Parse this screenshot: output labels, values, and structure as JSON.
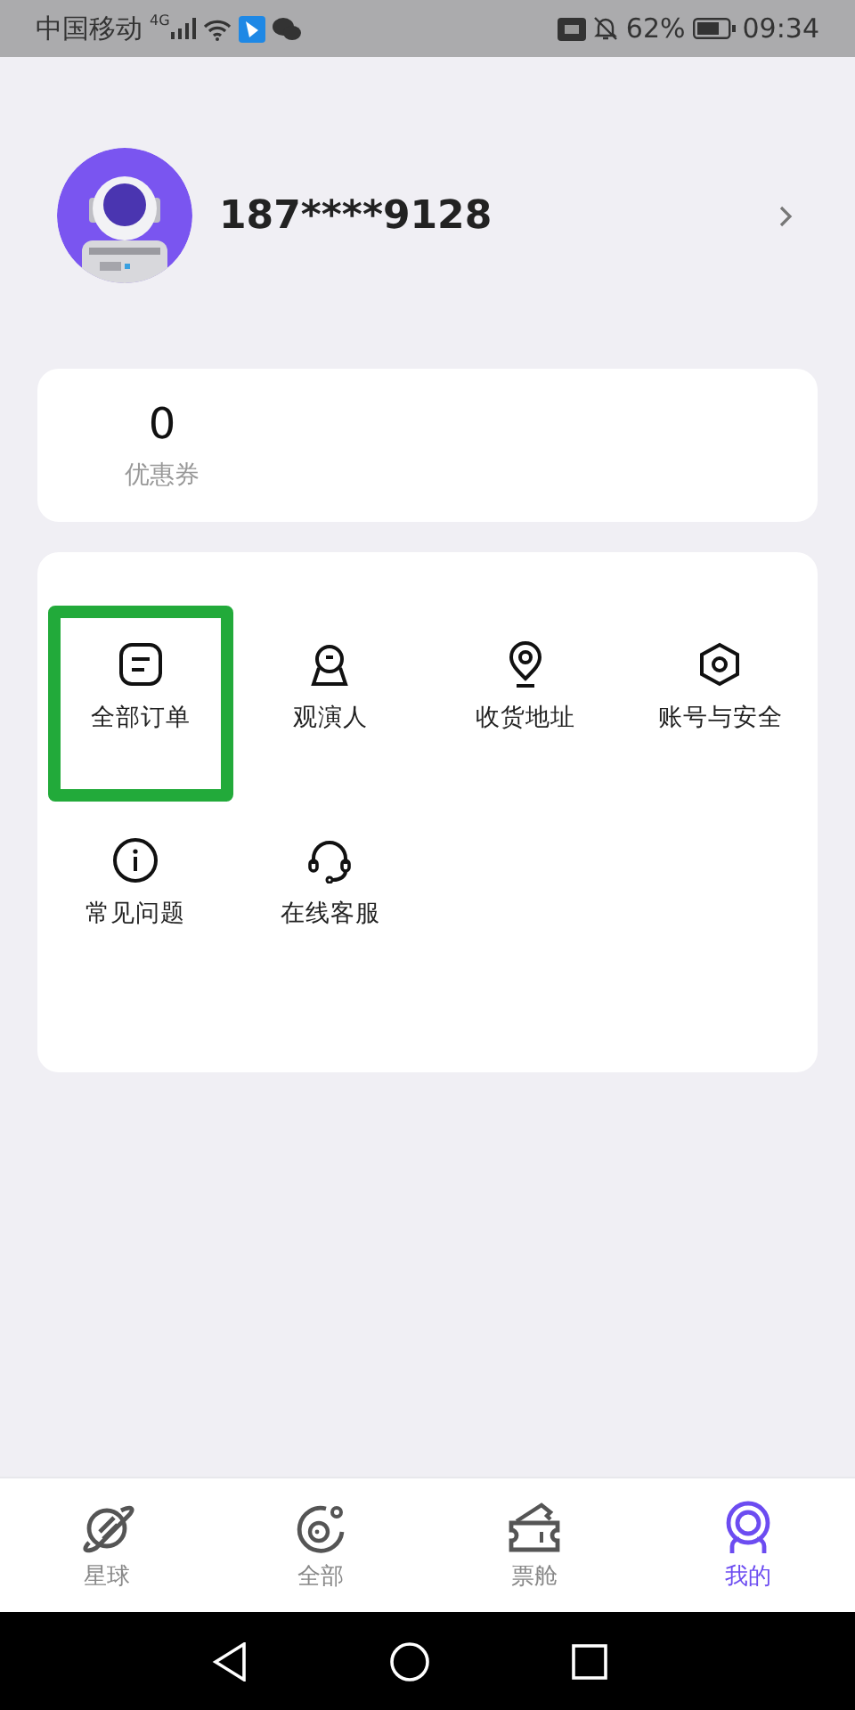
{
  "status_bar": {
    "carrier": "中国移动",
    "network": "4G",
    "battery": "62%",
    "time": "09:34"
  },
  "profile": {
    "phone": "187****9128"
  },
  "coupons": {
    "count": "0",
    "label": "优惠券"
  },
  "services": [
    {
      "kind": "orders",
      "label": "全部订单",
      "highlighted": true
    },
    {
      "kind": "viewer",
      "label": "观演人",
      "highlighted": false
    },
    {
      "kind": "address",
      "label": "收货地址",
      "highlighted": false
    },
    {
      "kind": "security",
      "label": "账号与安全",
      "highlighted": false
    },
    {
      "kind": "faq",
      "label": "常见问题",
      "highlighted": false
    },
    {
      "kind": "support",
      "label": "在线客服",
      "highlighted": false
    }
  ],
  "tab_bar": [
    {
      "kind": "planet",
      "label": "星球",
      "selected": false
    },
    {
      "kind": "all",
      "label": "全部",
      "selected": false
    },
    {
      "kind": "ticket",
      "label": "票舱",
      "selected": false
    },
    {
      "kind": "me",
      "label": "我的",
      "selected": true
    }
  ]
}
